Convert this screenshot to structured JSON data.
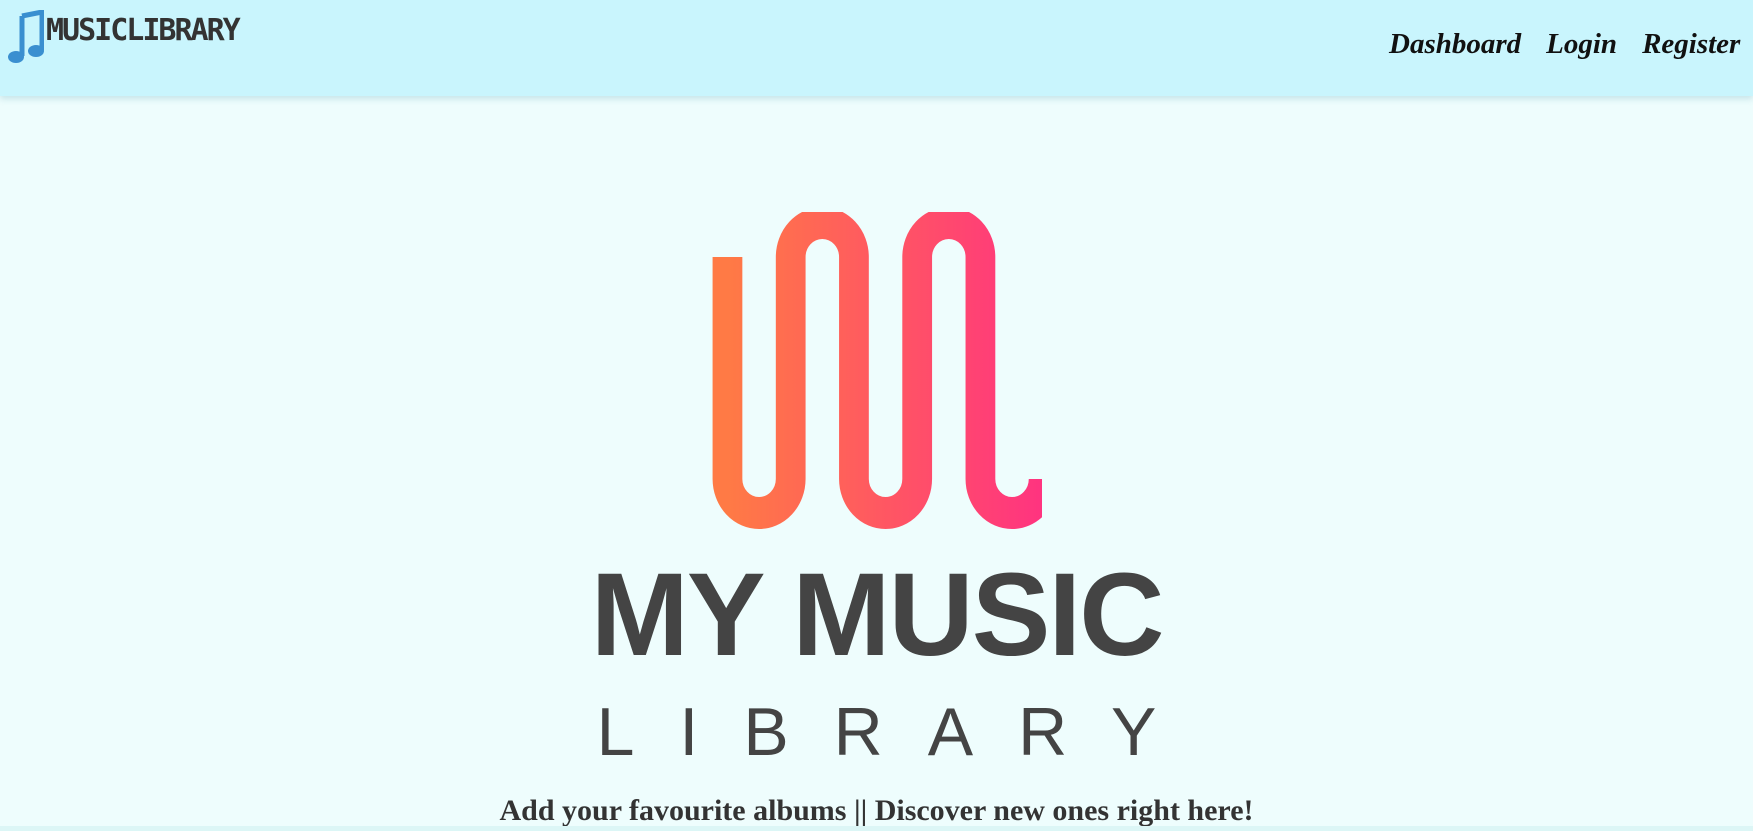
{
  "navbar": {
    "brand_text": "MUSICLIBRARY",
    "brand_icon": "music-note-icon",
    "links": [
      {
        "label": "Dashboard"
      },
      {
        "label": "Login"
      },
      {
        "label": "Register"
      }
    ]
  },
  "hero": {
    "logo_title": "MY MUSIC",
    "logo_subtitle": "LIBRARY",
    "tagline": "Add your favourite albums || Discover new ones right here!"
  },
  "colors": {
    "navbar_bg": "#c9f5fd",
    "page_bg": "#eefdfd",
    "brand_icon": "#3a8fd0",
    "logo_gradient_start": "#ff7a45",
    "logo_gradient_end": "#ff3380",
    "logo_text": "#444444"
  }
}
